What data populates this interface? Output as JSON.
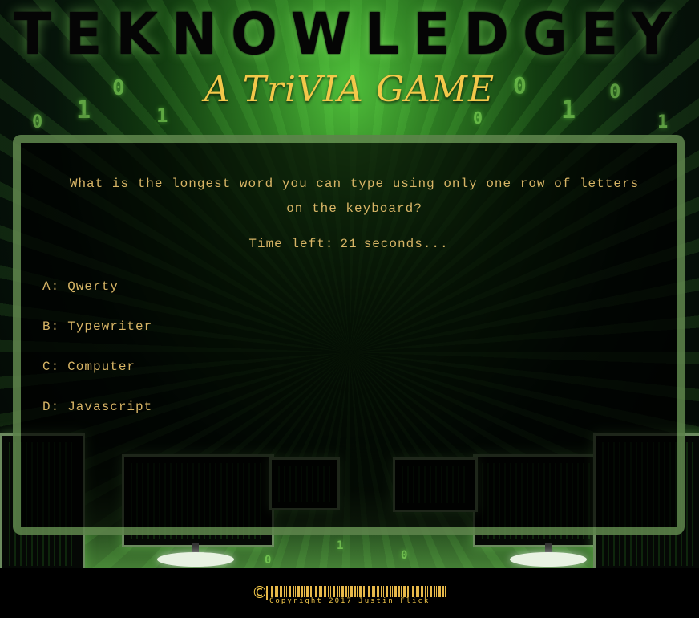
{
  "header": {
    "title": "TEKNOWLEDGEY",
    "subtitle": "A TriVIA GAME"
  },
  "quiz": {
    "question": "What is the longest word you can type using only one row of letters on the keyboard?",
    "timer_prefix": "Time left:",
    "timer_value": "21",
    "timer_suffix": "seconds...",
    "answers": [
      {
        "letter": "A:",
        "text": "Qwerty"
      },
      {
        "letter": "B:",
        "text": "Typewriter"
      },
      {
        "letter": "C:",
        "text": "Computer"
      },
      {
        "letter": "D:",
        "text": "Javascript"
      }
    ]
  },
  "footer": {
    "copyright_symbol": "©",
    "copyright_text": "Copyright 2017 Justin Flick"
  },
  "colors": {
    "accent_gold": "#d8b566",
    "matrix_green": "#4fbf3a"
  }
}
